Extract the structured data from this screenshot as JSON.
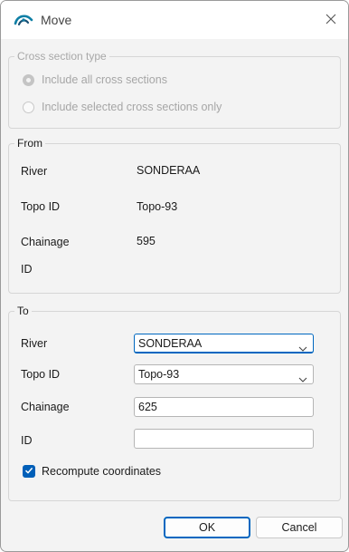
{
  "window": {
    "title": "Move"
  },
  "icons": {
    "app": "app-logo-icon",
    "close": "close-icon",
    "combo_arrow": "chevron-down-icon",
    "check": "checkmark-icon"
  },
  "colors": {
    "accent": "#0067c0",
    "checkbox": "#005fb8"
  },
  "cross_section_type": {
    "legend": "Cross section type",
    "option_all": "Include all cross sections",
    "option_selected": "Include selected cross sections only",
    "selected": "option_all",
    "enabled": false
  },
  "from": {
    "legend": "From",
    "river_label": "River",
    "river_value": "SONDERAA",
    "topo_label": "Topo ID",
    "topo_value": "Topo-93",
    "chainage_label": "Chainage",
    "chainage_value": "595",
    "id_label": "ID",
    "id_value": ""
  },
  "to": {
    "legend": "To",
    "river_label": "River",
    "river_value": "SONDERAA",
    "topo_label": "Topo ID",
    "topo_value": "Topo-93",
    "chainage_label": "Chainage",
    "chainage_value": "625",
    "id_label": "ID",
    "id_value": "",
    "recompute_label": "Recompute coordinates",
    "recompute_checked": true
  },
  "buttons": {
    "ok": "OK",
    "cancel": "Cancel"
  }
}
